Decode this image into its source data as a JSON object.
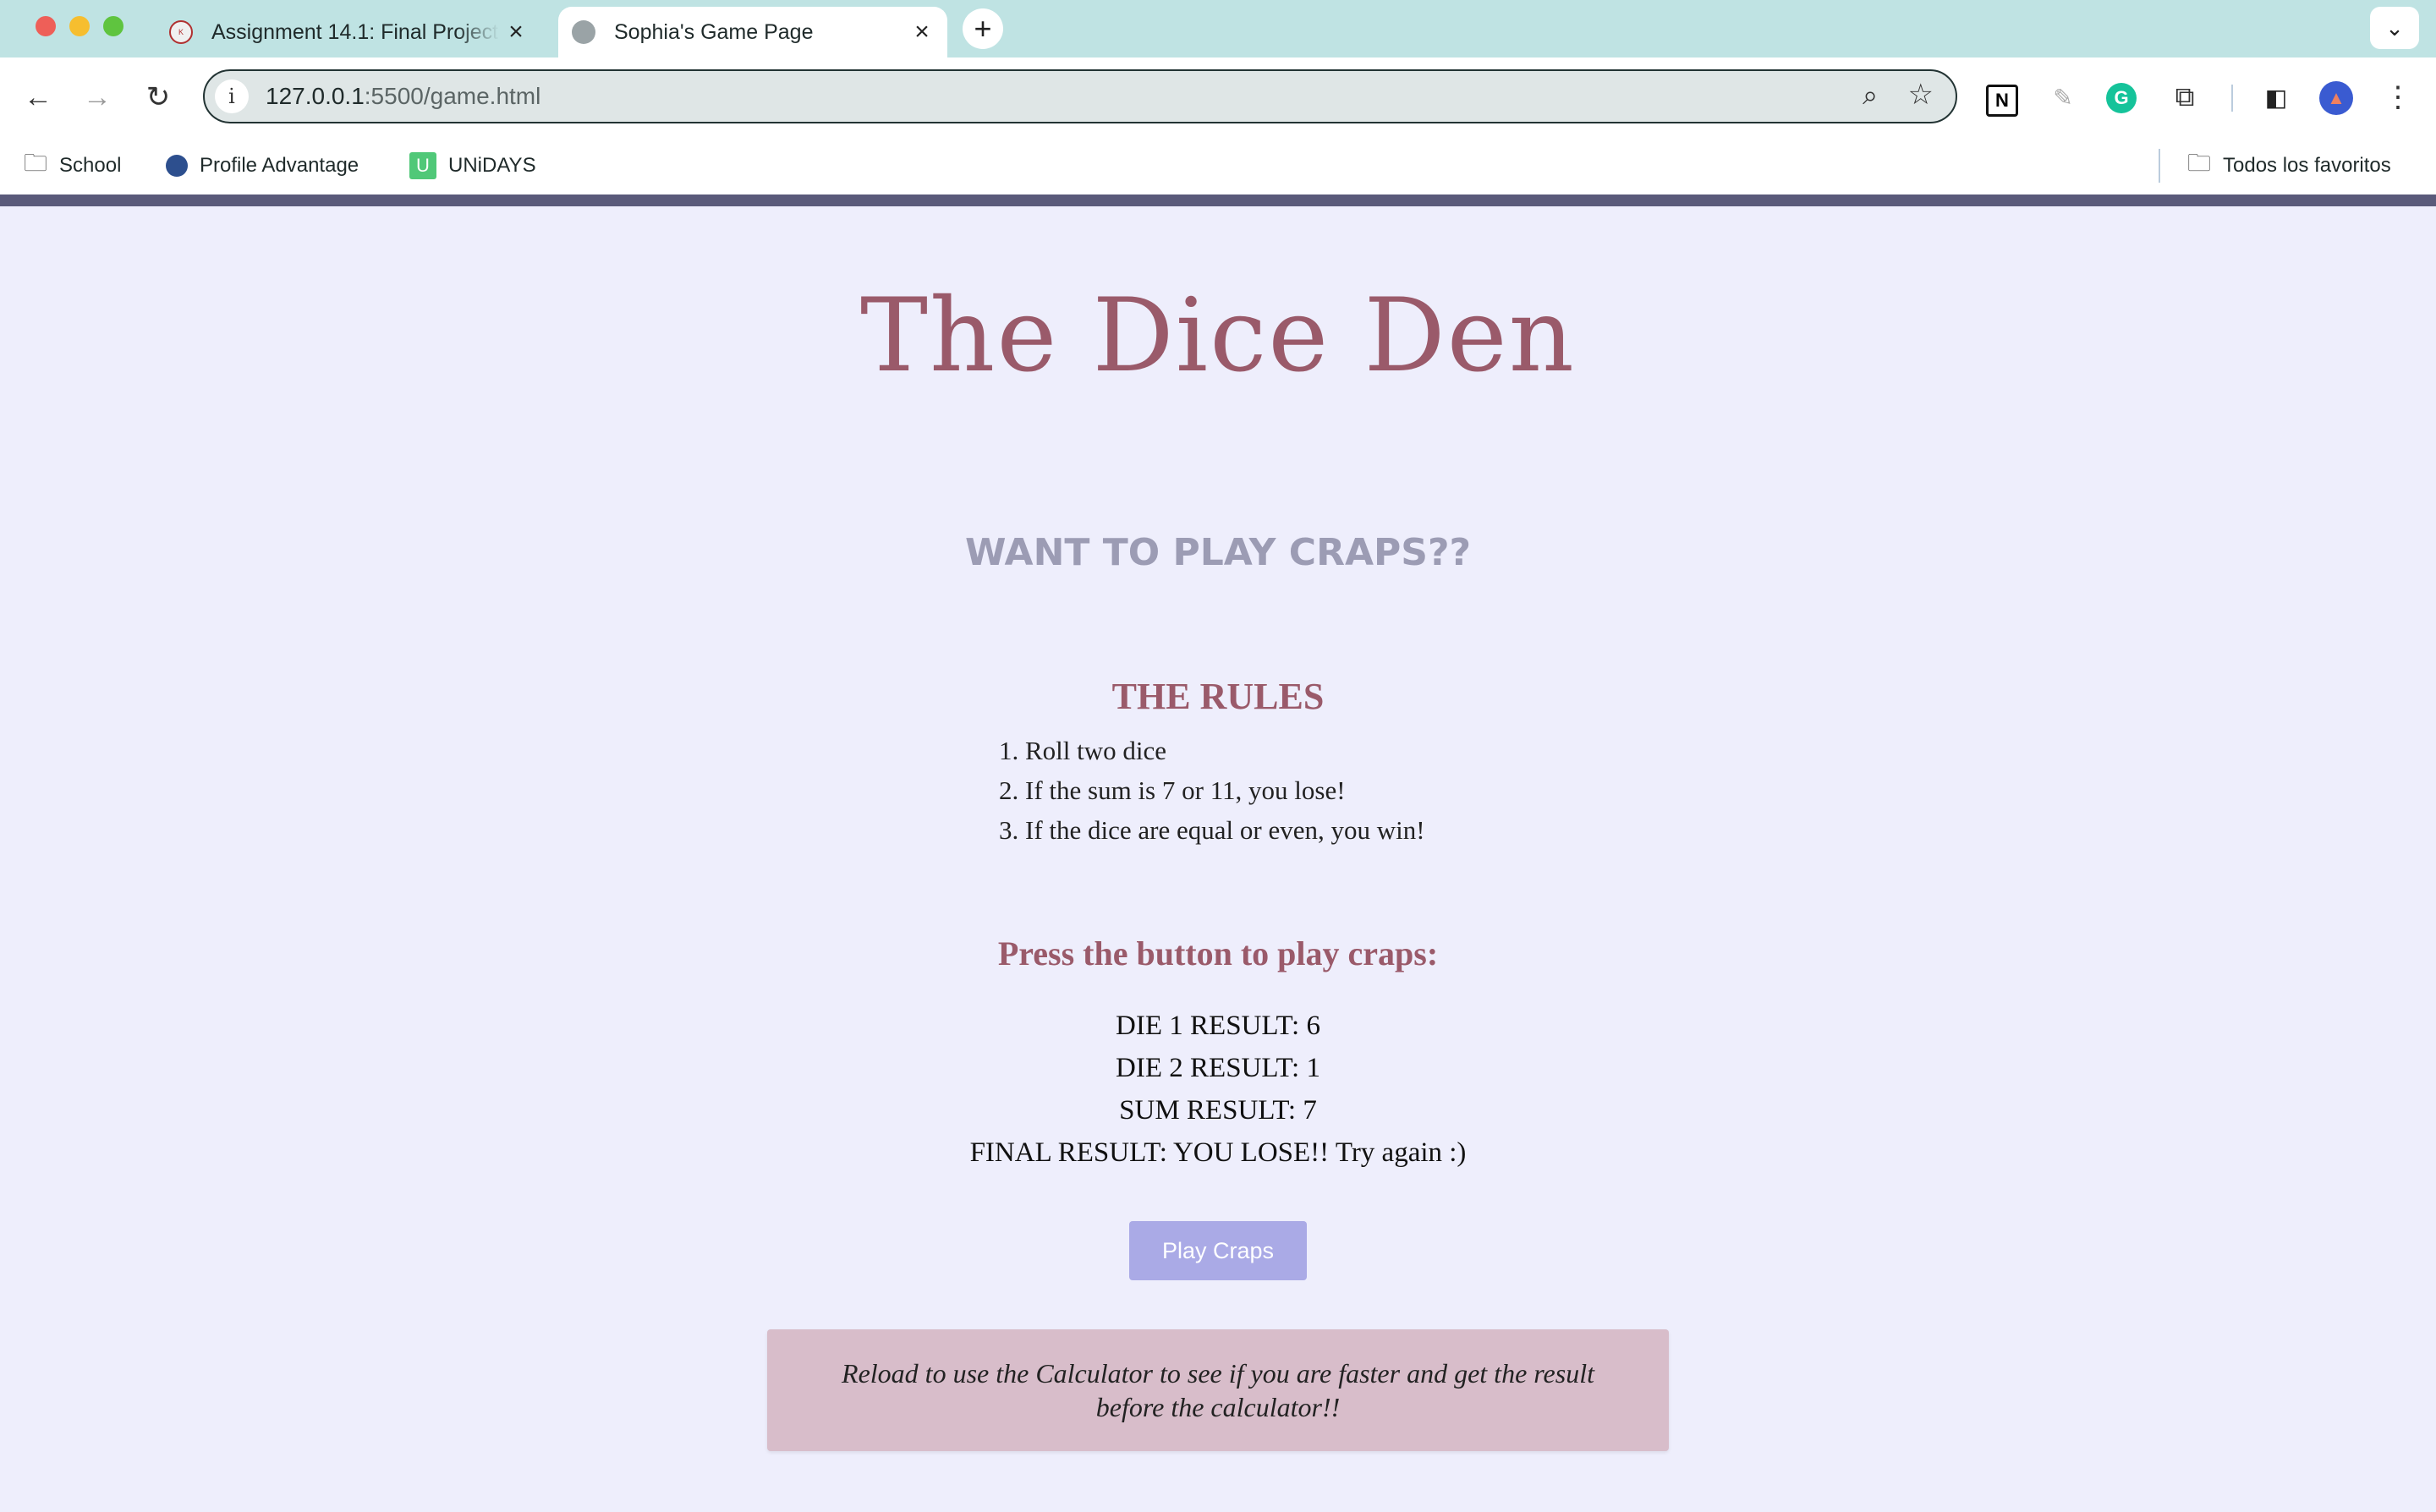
{
  "browser": {
    "tabs": [
      {
        "title": "Assignment 14.1: Final Project",
        "favicon": "course-icon"
      },
      {
        "title": "Sophia's Game Page",
        "favicon": "globe-icon"
      }
    ],
    "url_host": "127.0.0.1",
    "url_rest": ":5500/game.html",
    "bookmarks": {
      "school": "School",
      "profile": "Profile Advantage",
      "unidays": "UNiDAYS",
      "favorites": "Todos los favoritos"
    }
  },
  "page": {
    "title": "The Dice Den",
    "subtitle": "WANT TO PLAY CRAPS??",
    "rules_heading": "THE RULES",
    "rules": [
      "Roll two dice",
      "If the sum is 7 or 11, you lose!",
      "If the dice are equal or even, you win!"
    ],
    "press_text": "Press the button to play craps:",
    "results": {
      "die1": "DIE 1 RESULT: 6",
      "die2": "DIE 2 RESULT: 1",
      "sum": "SUM RESULT: 7",
      "final": "FINAL RESULT: YOU LOSE!! Try again :)"
    },
    "play_button": "Play Craps",
    "note": "Reload to use the Calculator to see if you are faster and get the result before the calculator!!"
  },
  "colors": {
    "accent_title": "#9a5a6a",
    "page_bg": "#eeeefc",
    "button_bg": "#aaaae6",
    "note_bg": "#d8bdca"
  }
}
